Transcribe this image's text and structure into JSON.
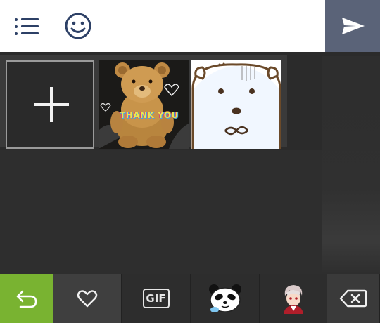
{
  "composer": {
    "menu_icon": "list-icon",
    "emoji_icon": "smiley-icon",
    "send_icon": "send-icon",
    "send_color": "#5a6378"
  },
  "stickers": {
    "add_icon": "plus-icon",
    "items": [
      {
        "name": "teddy-bear-sticker",
        "caption": "THANK YOU"
      },
      {
        "name": "polar-bear-sticker",
        "caption": ""
      }
    ]
  },
  "tabs": [
    {
      "name": "back-tab",
      "icon": "back-arrow-icon",
      "color": "#79b331"
    },
    {
      "name": "favorites-tab",
      "icon": "heart-icon"
    },
    {
      "name": "gif-tab",
      "label": "GIF"
    },
    {
      "name": "panda-sticker-tab",
      "icon": "panda-icon"
    },
    {
      "name": "anime-sticker-tab",
      "icon": "anime-character-icon"
    },
    {
      "name": "delete-tab",
      "icon": "backspace-icon"
    }
  ]
}
